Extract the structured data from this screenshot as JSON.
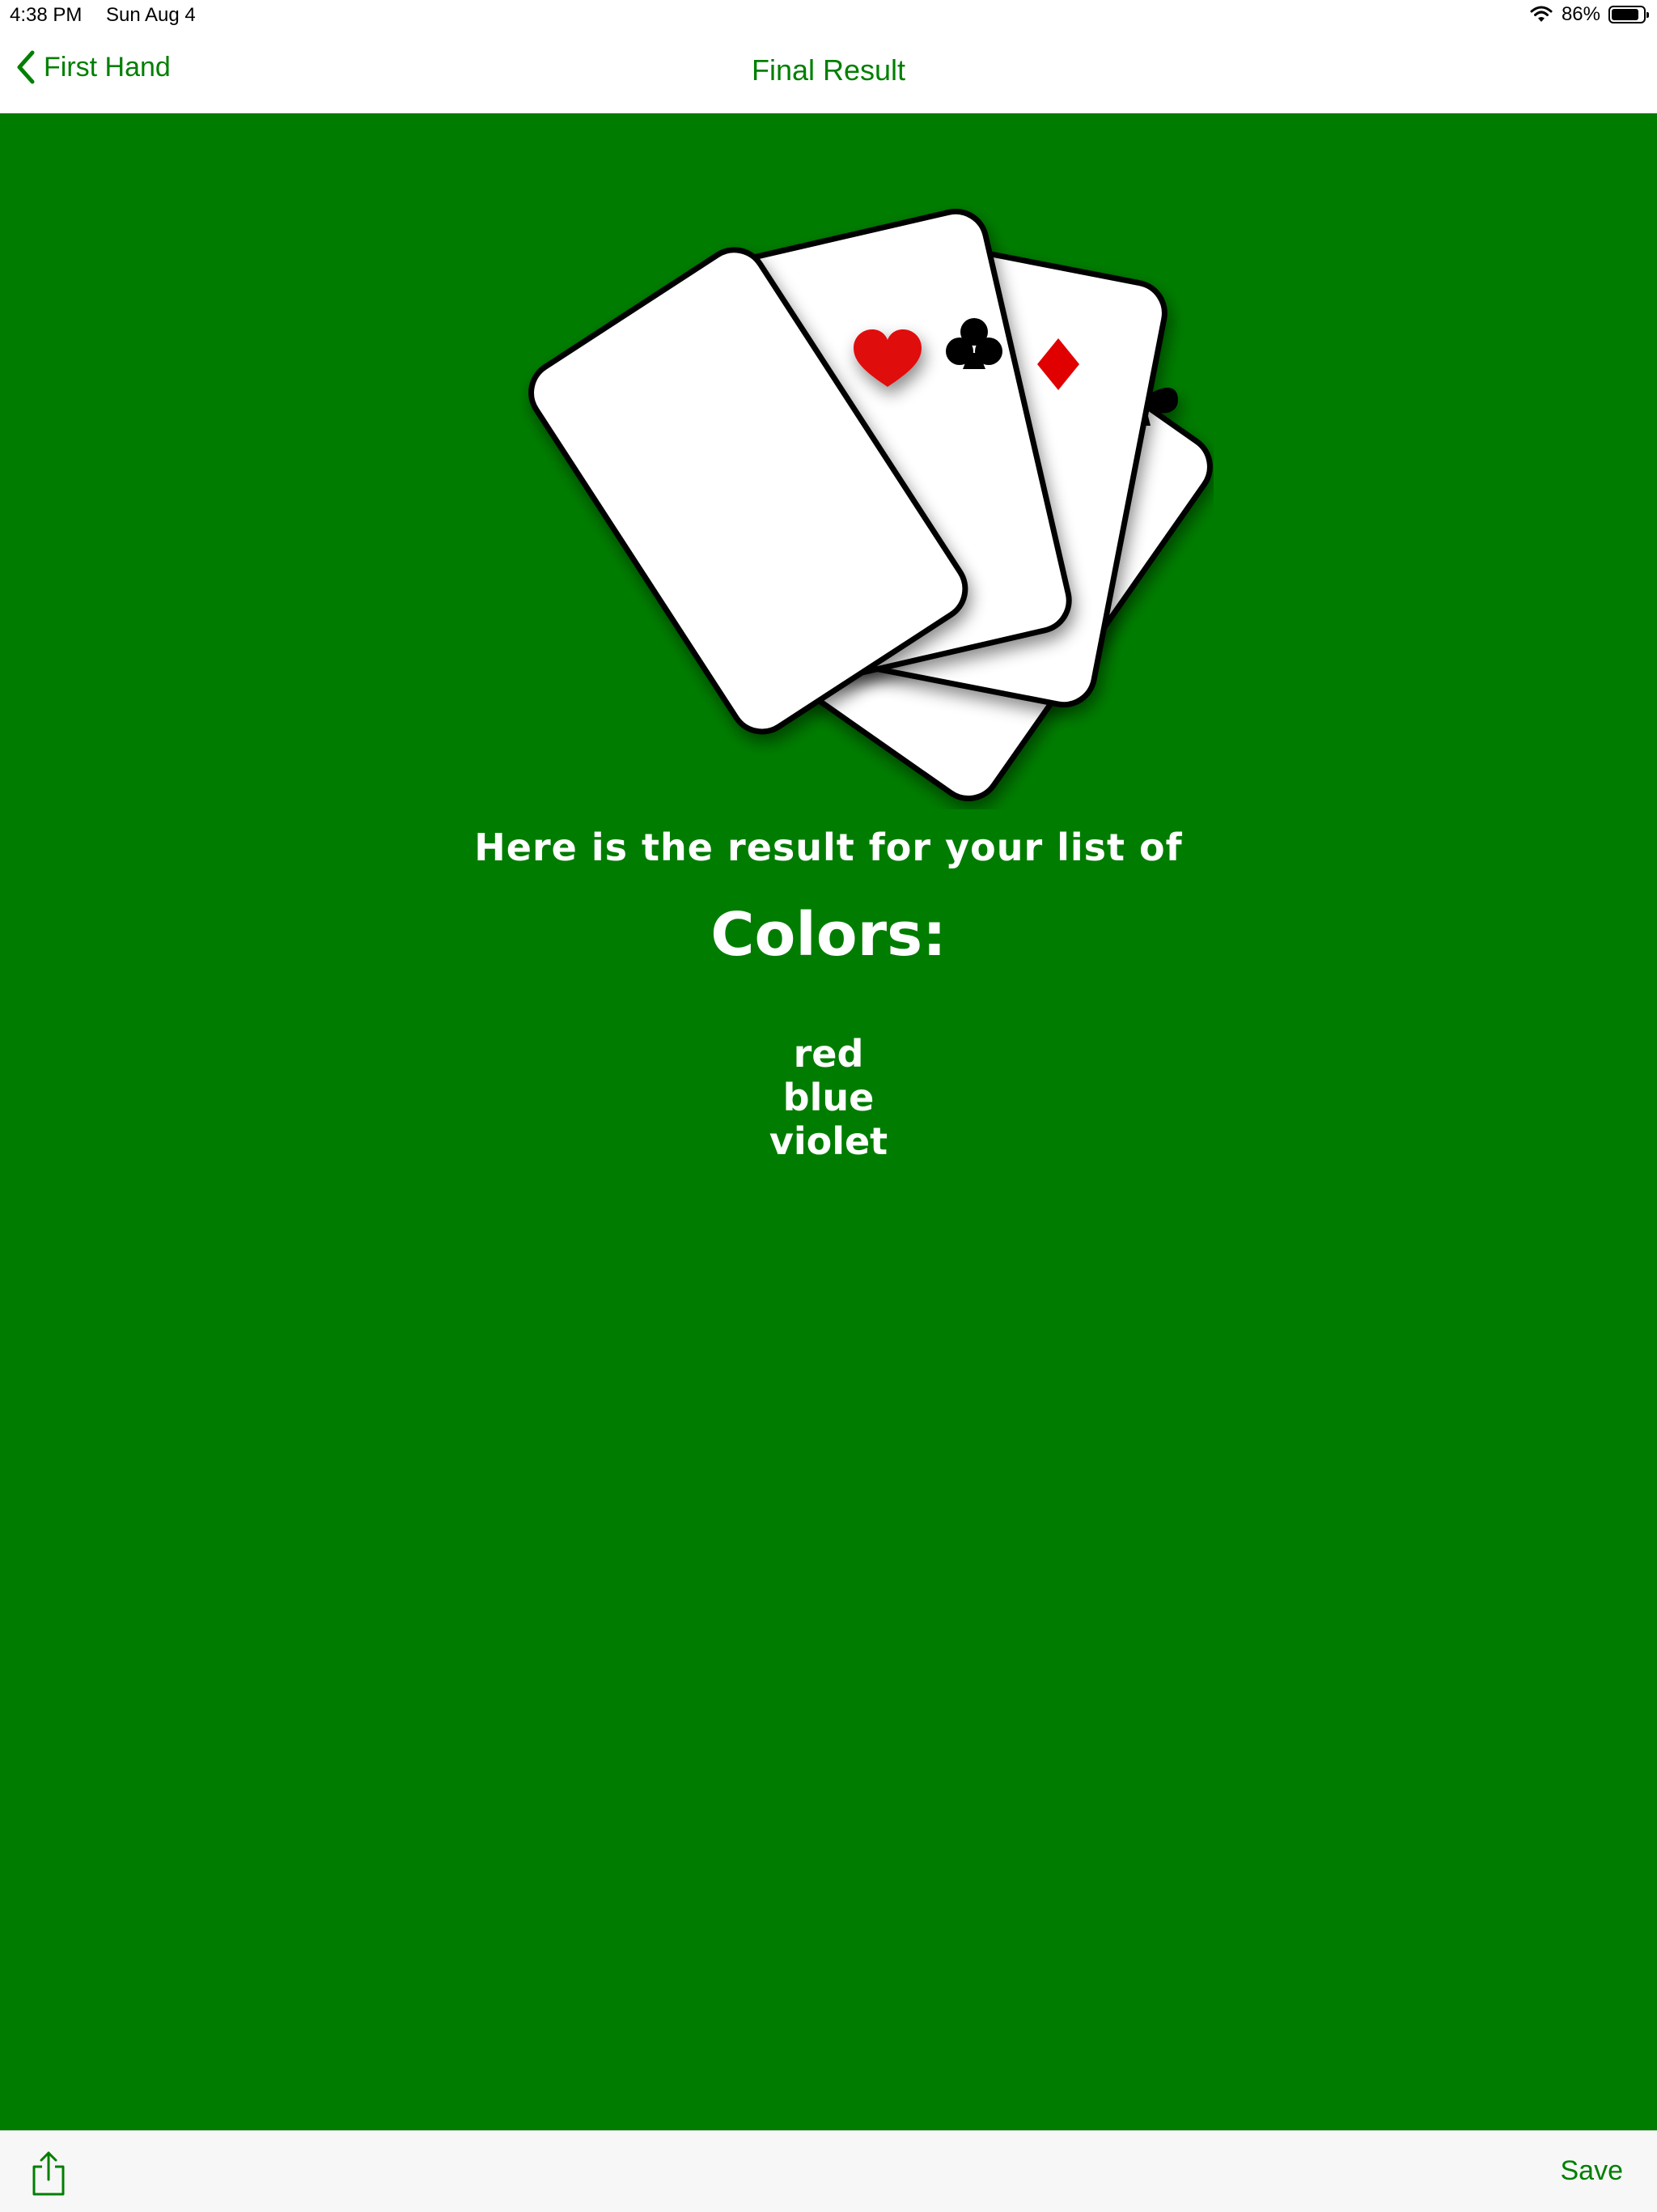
{
  "status_bar": {
    "time": "4:38 PM",
    "date": "Sun Aug 4",
    "battery": "86%",
    "battery_level": 0.86,
    "icons": [
      "wifi-icon",
      "battery-icon"
    ]
  },
  "nav": {
    "back_label": "First Hand",
    "title": "Final Result",
    "accent_color": "#007f00"
  },
  "illustration": {
    "cards": [
      "heart",
      "club",
      "diamond",
      "spade"
    ],
    "background_color": "#007d00"
  },
  "result": {
    "intro": "Here is the result for your list of",
    "list_title": "Colors:",
    "items": [
      "red",
      "blue",
      "violet"
    ]
  },
  "toolbar": {
    "share_icon": "share-icon",
    "save_label": "Save"
  }
}
